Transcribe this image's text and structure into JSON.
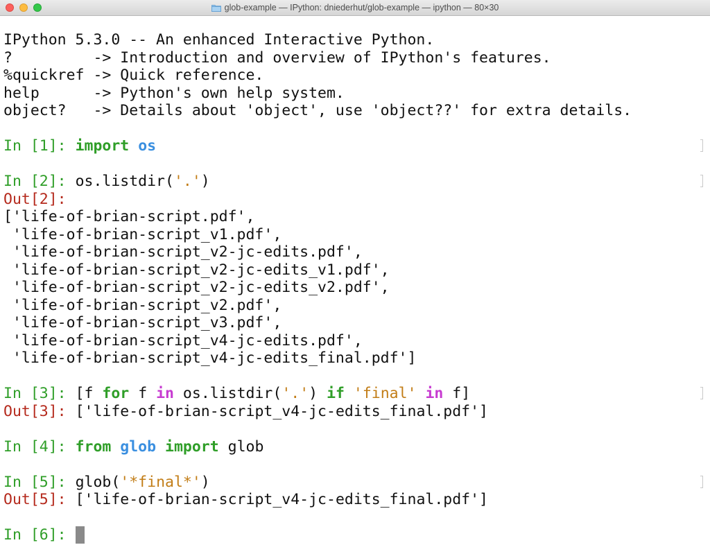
{
  "window": {
    "title": "glob-example — IPython: dniederhut/glob-example — ipython — 80×30"
  },
  "banner": [
    "IPython 5.3.0 -- An enhanced Interactive Python.",
    "?         -> Introduction and overview of IPython's features.",
    "%quickref -> Quick reference.",
    "help      -> Python's own help system.",
    "object?   -> Details about 'object', use 'object??' for extra details."
  ],
  "cell1": {
    "prompt": "In [1]: ",
    "kw_import": "import",
    "sp1": " ",
    "module": "os"
  },
  "cell2": {
    "prompt": "In [2]: ",
    "code_a": "os.listdir(",
    "str_dot": "'.'",
    "code_b": ")",
    "out_label": "Out[2]:",
    "output": [
      "['life-of-brian-script.pdf',",
      " 'life-of-brian-script_v1.pdf',",
      " 'life-of-brian-script_v2-jc-edits.pdf',",
      " 'life-of-brian-script_v2-jc-edits_v1.pdf',",
      " 'life-of-brian-script_v2-jc-edits_v2.pdf',",
      " 'life-of-brian-script_v2.pdf',",
      " 'life-of-brian-script_v3.pdf',",
      " 'life-of-brian-script_v4-jc-edits.pdf',",
      " 'life-of-brian-script_v4-jc-edits_final.pdf']"
    ]
  },
  "cell3": {
    "prompt": "In [3]: ",
    "t1": "[f ",
    "kw_for": "for",
    "t2": " f ",
    "op_in1": "in",
    "t3": " os.listdir(",
    "str_dot": "'.'",
    "t4": ") ",
    "kw_if": "if",
    "t5": " ",
    "str_final": "'final'",
    "t6": " ",
    "op_in2": "in",
    "t7": " f]",
    "out_label": "Out[3]: ",
    "output": "['life-of-brian-script_v4-jc-edits_final.pdf']"
  },
  "cell4": {
    "prompt": "In [4]: ",
    "kw_from": "from",
    "sp1": " ",
    "module": "glob",
    "sp2": " ",
    "kw_import": "import",
    "rest": " glob"
  },
  "cell5": {
    "prompt": "In [5]: ",
    "code_a": "glob(",
    "str_pattern": "'*final*'",
    "code_b": ")",
    "out_label": "Out[5]: ",
    "output": "['life-of-brian-script_v4-jc-edits_final.pdf']"
  },
  "cell6": {
    "prompt": "In [6]: "
  },
  "colors": {
    "prompt_green": "#2f9e28",
    "out_red": "#b52a1d",
    "keyword_green": "#2f9e28",
    "module_blue": "#3a8fe0",
    "string_orange": "#c27d17",
    "operator_magenta": "#c73bd1"
  }
}
